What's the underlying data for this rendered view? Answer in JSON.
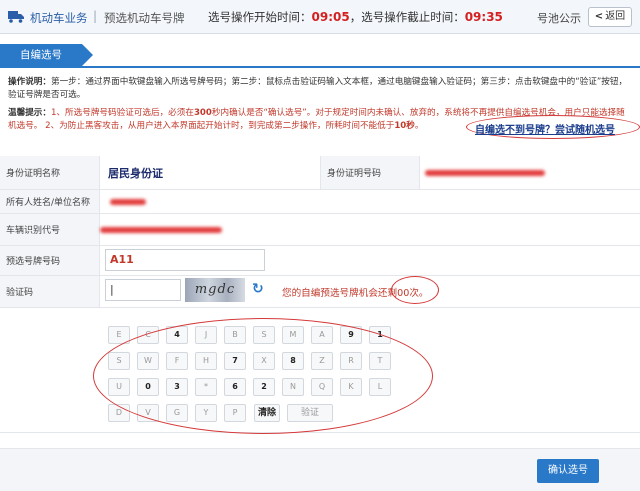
{
  "header": {
    "nav_primary": "机动车业务",
    "nav_separator": "|",
    "nav_secondary": "预选机动车号牌",
    "start_label": "选号操作开始时间：",
    "start_time": "09:05",
    "end_label": "，选号操作截止时间：",
    "end_time": "09:35",
    "pool_label": "号池公示",
    "back_label": "返回",
    "back_chevron": "<"
  },
  "tab": {
    "label": "自编选号"
  },
  "instructions": {
    "heading": "操作说明：",
    "text": "第一步：通过界面中软键盘输入所选号牌号码；第二步：鼠标点击验证码输入文本框，通过电脑键盘输入验证码；第三步：点击软键盘中的“验证”按钮，验证号牌是否可选。"
  },
  "tips": {
    "heading": "温馨提示：",
    "text1": "1、所选号牌号码验证可选后，必须在",
    "limit1": "300",
    "text2": "秒内确认是否“确认选号”。对于规定时间内未确认、放弃的，系统将不再提供自编选号机会，用户只能选择随机选号。 2、为防止黑客攻击，从用户进入本界面起开始计时，到完成第二步操作，所耗时间不能低于",
    "limit2": "10秒",
    "text3": "。"
  },
  "random_link": "自编选不到号牌？尝试随机选号",
  "form": {
    "id_type_label": "身份证明名称",
    "id_type_value": "居民身份证",
    "id_number_label": "身份证明号码",
    "owner_label": "所有人姓名/单位名称",
    "vin_label": "车辆识别代号",
    "plate_label": "预选号牌号码",
    "plate_value": "A11",
    "captcha_label": "验证码",
    "captcha_text": "mgdc",
    "refresh_glyph": "↻",
    "chances_text1": "您的自编预选号牌机会还剩",
    "chances_count": "00",
    "chances_text2": "次。"
  },
  "keypad": {
    "row1": [
      "E",
      "C",
      "4",
      "J",
      "B",
      "S",
      "M",
      "A",
      "9",
      "1"
    ],
    "row2": [
      "S",
      "W",
      "F",
      "H",
      "7",
      "X",
      "8",
      "Z",
      "R",
      "T"
    ],
    "row3": [
      "U",
      "0",
      "3",
      "*",
      "6",
      "2",
      "N",
      "Q",
      "K",
      "L"
    ],
    "row4": [
      "D",
      "V",
      "G",
      "Y",
      "P"
    ],
    "clear_label": "清除",
    "verify_label": "验证"
  },
  "footer": {
    "confirm_label": "确认选号"
  },
  "colors": {
    "accent": "#2a79c9",
    "warning": "#c0392b",
    "annotation": "#d43a3a"
  }
}
